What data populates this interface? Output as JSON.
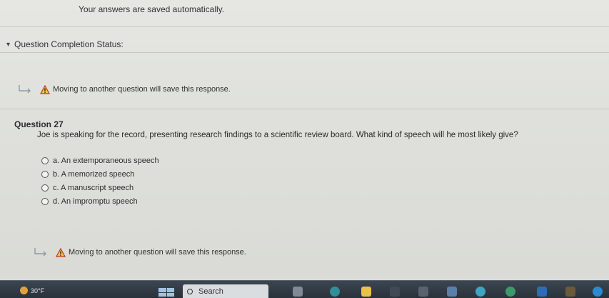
{
  "header": {
    "saved_text": "Your answers are saved automatically."
  },
  "status": {
    "label": "Question Completion Status:"
  },
  "warning_top": {
    "text": "Moving to another question will save this response."
  },
  "question": {
    "title": "Question 27",
    "text": "Joe is speaking for the record, presenting research findings to a scientific review board. What kind of speech will he most likely give?",
    "options": [
      "a. An extemporaneous speech",
      "b. A memorized speech",
      "c. A manuscript speech",
      "d. An impromptu speech"
    ]
  },
  "warning_bottom": {
    "text": "Moving to another question will save this response."
  },
  "taskbar": {
    "weather": "30°F",
    "search_placeholder": "Search"
  }
}
